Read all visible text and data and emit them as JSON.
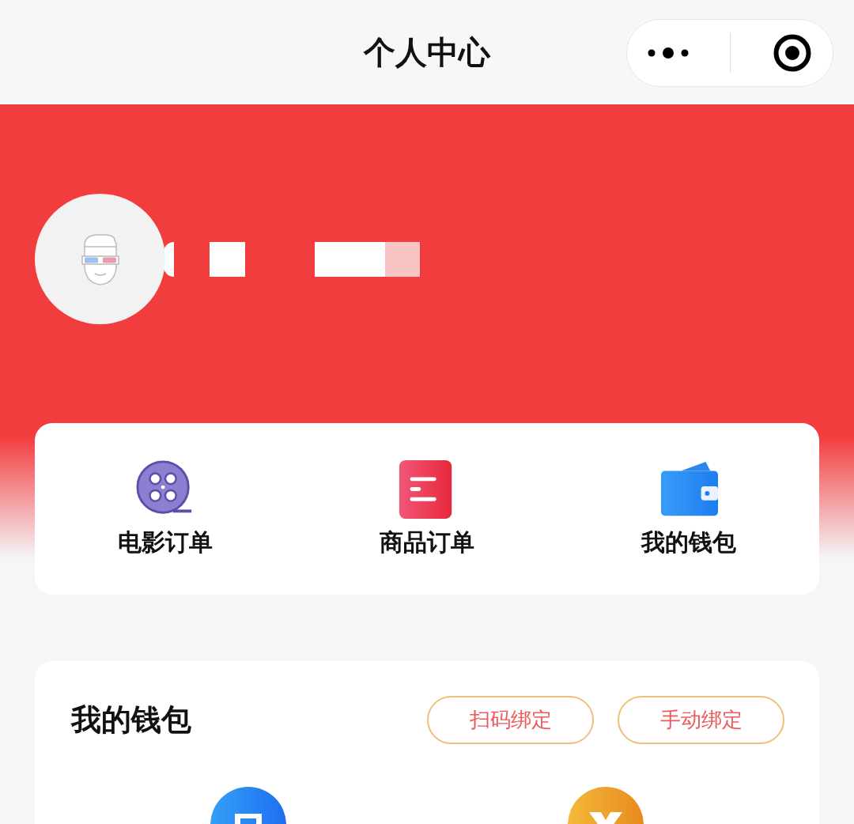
{
  "navigation_bar": {
    "title": "个人中心"
  },
  "shortcuts": [
    {
      "label": "电影订单",
      "kind": "movie"
    },
    {
      "label": "商品订单",
      "kind": "goods"
    },
    {
      "label": "我的钱包",
      "kind": "wallet"
    }
  ],
  "wallet": {
    "title": "我的钱包",
    "buttons": [
      "扫码绑定",
      "手动绑定"
    ],
    "items": [
      {
        "kind": "card"
      },
      {
        "kind": "coin"
      }
    ]
  }
}
